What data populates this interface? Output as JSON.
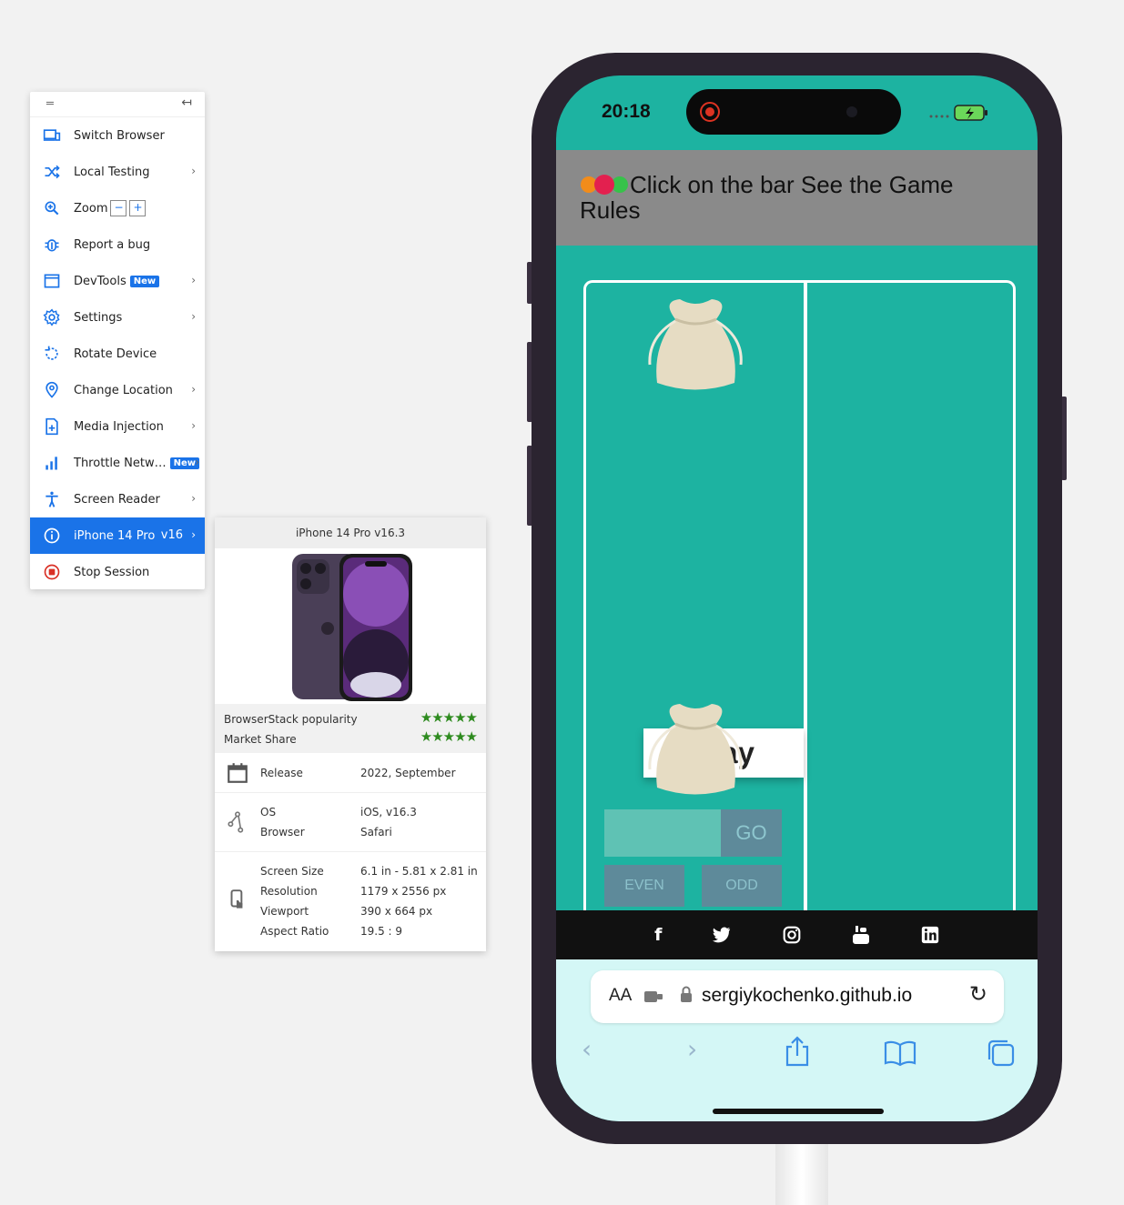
{
  "menu": {
    "items": [
      {
        "label": "Switch Browser"
      },
      {
        "label": "Local Testing"
      },
      {
        "label": "Zoom"
      },
      {
        "label": "Report a bug"
      },
      {
        "label": "DevTools",
        "badge": "New"
      },
      {
        "label": "Settings"
      },
      {
        "label": "Rotate Device"
      },
      {
        "label": "Change Location"
      },
      {
        "label": "Media Injection"
      },
      {
        "label": "Throttle Netw…",
        "badge": "New"
      },
      {
        "label": "Screen Reader"
      },
      {
        "label": "iPhone 14 Pro",
        "version": "v16"
      },
      {
        "label": "Stop Session"
      }
    ],
    "zoom_minus": "−",
    "zoom_plus": "+"
  },
  "device_card": {
    "title": "iPhone 14 Pro v16.3",
    "popularity_label": "BrowserStack popularity",
    "market_share_label": "Market Share",
    "popularity_stars": 5,
    "market_share_stars": 5,
    "release_label": "Release",
    "release_value": "2022, September",
    "os_label": "OS",
    "os_value": "iOS, v16.3",
    "browser_label": "Browser",
    "browser_value": "Safari",
    "screen_size_label": "Screen Size",
    "screen_size_value": "6.1 in - 5.81 x 2.81 in",
    "resolution_label": "Resolution",
    "resolution_value": "1179 x 2556 px",
    "viewport_label": "Viewport",
    "viewport_value": "390 x 664 px",
    "aspect_label": "Aspect Ratio",
    "aspect_value": "19.5 : 9"
  },
  "phone": {
    "time": "20:18",
    "banner_text": "Click on the bar See the Game Rules",
    "play_label": "Play",
    "go_label": "GO",
    "even_label": "EVEN",
    "odd_label": "ODD",
    "url_aa": "AA",
    "url": "sergiykochenko.github.io"
  },
  "colors": {
    "accent": "#1a73e8",
    "teal": "#1db3a1",
    "star_green": "#2e8b1f"
  }
}
